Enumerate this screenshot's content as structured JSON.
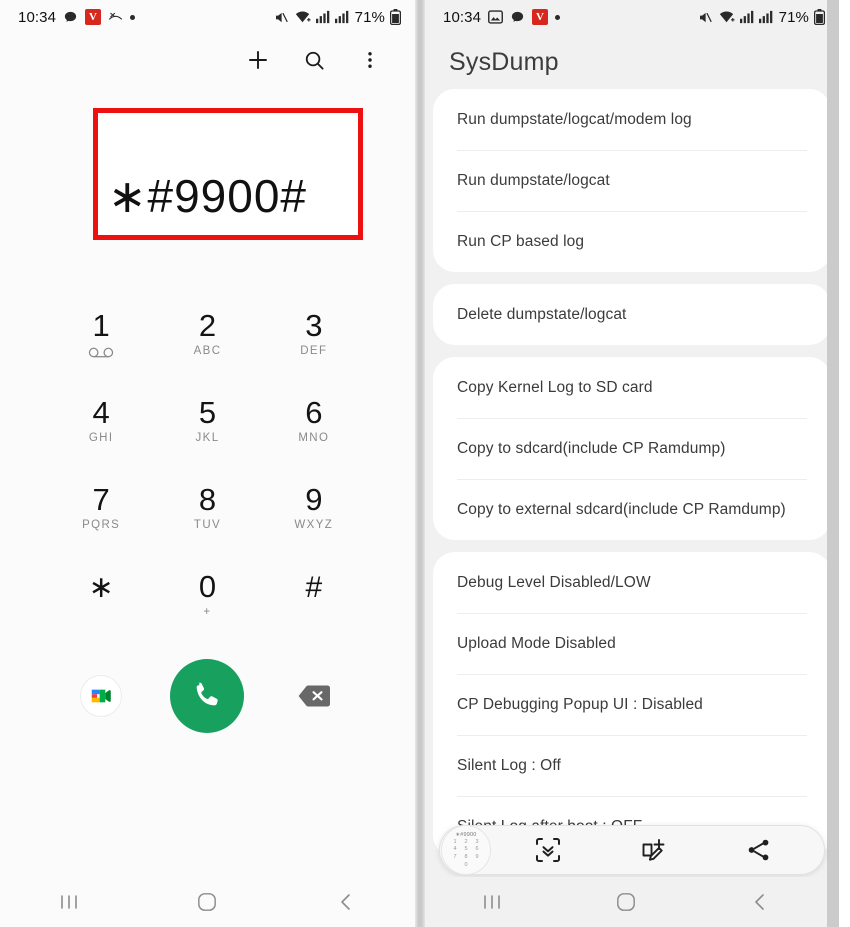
{
  "left_panel": {
    "statusbar": {
      "clock": "10:34",
      "battery_percent": "71%",
      "left_icons": [
        "chat-bubble-icon",
        "vivaldi-badge-icon",
        "missed-call-icon",
        "dot-icon"
      ],
      "right_icons": [
        "mute-icon",
        "wifi-icon",
        "signal-icon",
        "signal-icon",
        "battery-icon"
      ],
      "vivaldi_badge_text": "V"
    },
    "topbar": {
      "icons": [
        "add-contact-icon",
        "search-icon",
        "overflow-menu-icon"
      ]
    },
    "dialed_number": "∗#9900#",
    "highlight_color": "#ee1111",
    "keypad": [
      {
        "digit": "1",
        "sub": "",
        "icon": "voicemail-icon"
      },
      {
        "digit": "2",
        "sub": "ABC",
        "icon": ""
      },
      {
        "digit": "3",
        "sub": "DEF",
        "icon": ""
      },
      {
        "digit": "4",
        "sub": "GHI",
        "icon": ""
      },
      {
        "digit": "5",
        "sub": "JKL",
        "icon": ""
      },
      {
        "digit": "6",
        "sub": "MNO",
        "icon": ""
      },
      {
        "digit": "7",
        "sub": "PQRS",
        "icon": ""
      },
      {
        "digit": "8",
        "sub": "TUV",
        "icon": ""
      },
      {
        "digit": "9",
        "sub": "WXYZ",
        "icon": ""
      },
      {
        "digit": "∗",
        "sub": "",
        "icon": ""
      },
      {
        "digit": "0",
        "sub": "+",
        "icon": ""
      },
      {
        "digit": "#",
        "sub": "",
        "icon": ""
      }
    ],
    "actions": {
      "video_call": "google-meet-icon",
      "call": "call-icon",
      "backspace": "backspace-icon",
      "call_button_color": "#17a05e"
    },
    "navbar": [
      "recents-icon",
      "home-icon",
      "back-icon"
    ]
  },
  "right_panel": {
    "statusbar": {
      "clock": "10:34",
      "battery_percent": "71%",
      "left_icons": [
        "screenshot-icon",
        "chat-bubble-icon",
        "vivaldi-badge-icon",
        "dot-icon"
      ],
      "right_icons": [
        "mute-icon",
        "wifi-icon",
        "signal-icon",
        "signal-icon",
        "battery-icon"
      ],
      "vivaldi_badge_text": "V"
    },
    "title": "SysDump",
    "cards": [
      {
        "items": [
          "Run dumpstate/logcat/modem log",
          "Run dumpstate/logcat",
          "Run CP based log"
        ]
      },
      {
        "items": [
          "Delete dumpstate/logcat"
        ]
      },
      {
        "items": [
          "Copy Kernel Log to SD card",
          "Copy to sdcard(include CP Ramdump)",
          "Copy to external sdcard(include CP Ramdump)"
        ]
      },
      {
        "items": [
          "Debug Level Disabled/LOW",
          "Upload Mode Disabled",
          "CP Debugging Popup UI : Disabled",
          "Silent Log : Off",
          "Silent Log after boot : OFF"
        ]
      }
    ],
    "screenshot_toolbar": {
      "thumbnail_label": "∗#9900",
      "thumbnail_keys": [
        "1",
        "2",
        "3",
        "4",
        "5",
        "6",
        "7",
        "8",
        "9"
      ],
      "thumbnail_zero": "0",
      "buttons": [
        "scroll-capture-icon",
        "crop-markup-icon",
        "share-icon"
      ]
    },
    "navbar": [
      "recents-icon",
      "home-icon",
      "back-icon"
    ]
  }
}
